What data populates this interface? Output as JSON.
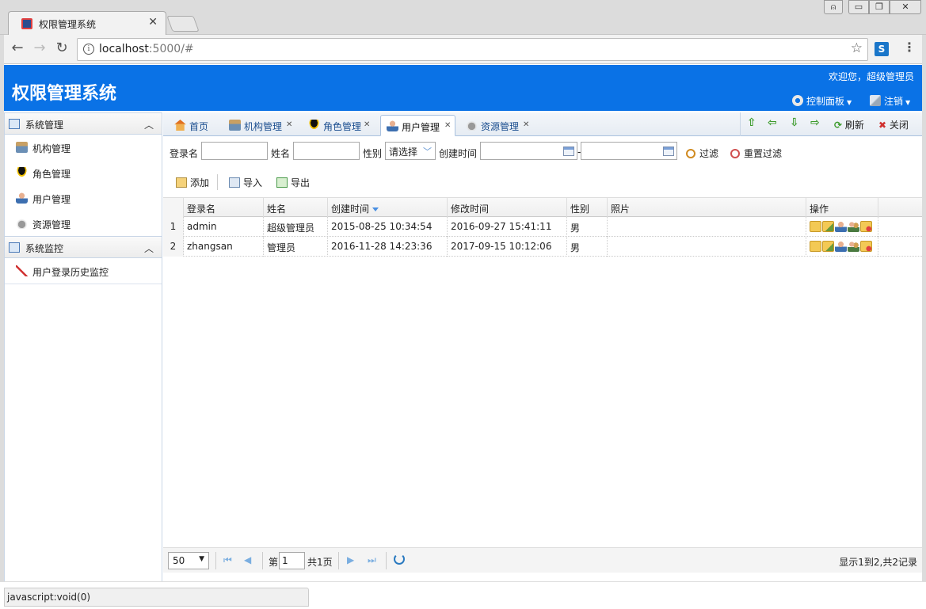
{
  "browser": {
    "tab_title": "权限管理系统",
    "url_host": "localhost",
    "url_path": ":5000/#"
  },
  "header": {
    "title": "权限管理系统",
    "welcome": "欢迎您，超级管理员",
    "control_panel": "控制面板",
    "logout": "注销",
    "bg_color": "#0a72e6"
  },
  "sidebar": {
    "groups": [
      {
        "label": "系统管理",
        "items": [
          {
            "label": "机构管理",
            "icon": "org-icon"
          },
          {
            "label": "角色管理",
            "icon": "role-icon"
          },
          {
            "label": "用户管理",
            "icon": "user-icon"
          },
          {
            "label": "资源管理",
            "icon": "resource-icon"
          }
        ]
      },
      {
        "label": "系统监控",
        "items": [
          {
            "label": "用户登录历史监控",
            "icon": "history-icon"
          }
        ]
      }
    ]
  },
  "tabs": [
    {
      "label": "首页",
      "icon": "home-icon"
    },
    {
      "label": "机构管理",
      "icon": "org-icon"
    },
    {
      "label": "角色管理",
      "icon": "role-icon"
    },
    {
      "label": "用户管理",
      "icon": "user-icon",
      "active": true
    },
    {
      "label": "资源管理",
      "icon": "resource-icon"
    }
  ],
  "tab_tools": {
    "refresh": "刷新",
    "close": "关闭"
  },
  "filter": {
    "login_label": "登录名",
    "name_label": "姓名",
    "gender_label": "性别",
    "gender_value": "请选择",
    "created_label": "创建时间",
    "range_sep": "-",
    "filter_btn": "过滤",
    "reset_btn": "重置过滤"
  },
  "actions": {
    "add": "添加",
    "import": "导入",
    "export": "导出"
  },
  "grid": {
    "columns": [
      "登录名",
      "姓名",
      "创建时间",
      "修改时间",
      "性别",
      "照片",
      "操作"
    ],
    "rows": [
      {
        "num": "1",
        "login": "admin",
        "name": "超级管理员",
        "created": "2015-08-25 10:34:54",
        "modified": "2016-09-27 15:41:11",
        "gender": "男",
        "photo": ""
      },
      {
        "num": "2",
        "login": "zhangsan",
        "name": "管理员",
        "created": "2016-11-28 14:23:36",
        "modified": "2017-09-15 10:12:06",
        "gender": "男",
        "photo": ""
      }
    ]
  },
  "pager": {
    "page_size": "50",
    "page_prefix": "第",
    "page_value": "1",
    "page_total": "共1页",
    "info": "显示1到2,共2记录"
  },
  "statusbar": {
    "text": "javascript:void(0)"
  }
}
